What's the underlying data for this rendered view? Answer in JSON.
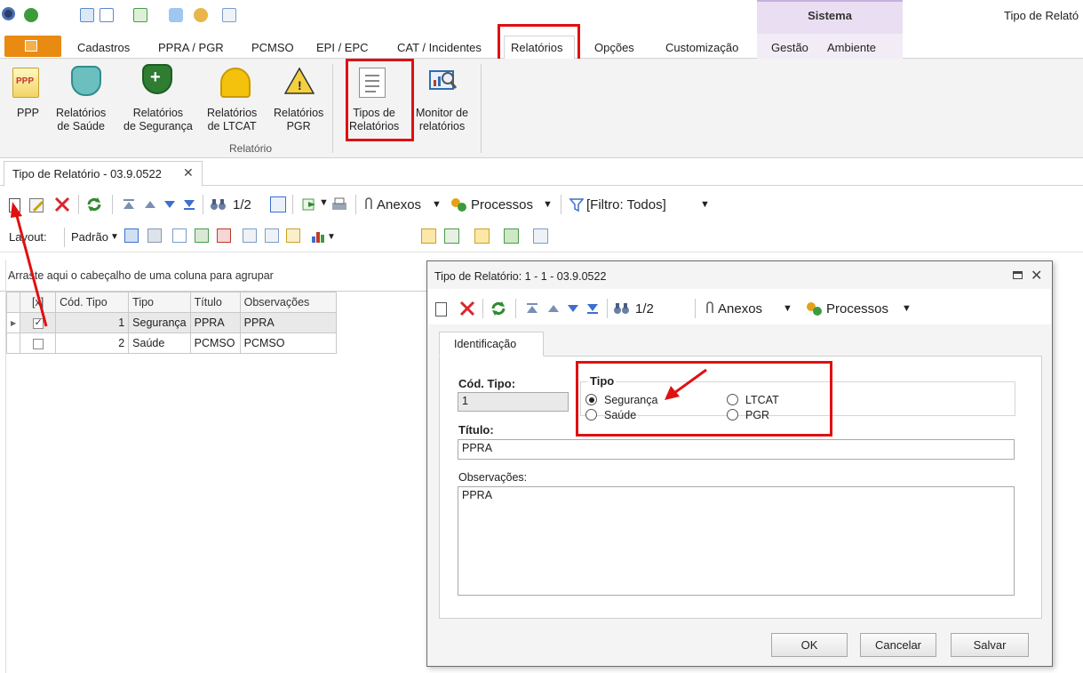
{
  "window": {
    "title": "Tipo de Relató",
    "sistema": "Sistema"
  },
  "ribbon": {
    "tabs": [
      "Cadastros",
      "PPRA / PGR",
      "PCMSO",
      "EPI / EPC",
      "CAT / Incidentes",
      "Relatórios",
      "Opções",
      "Customização",
      "Gestão",
      "Ambiente"
    ],
    "active_tab": "Relatórios",
    "buttons": [
      {
        "line1": "PPP",
        "line2": ""
      },
      {
        "line1": "Relatórios",
        "line2": "de Saúde"
      },
      {
        "line1": "Relatórios",
        "line2": "de Segurança"
      },
      {
        "line1": "Relatórios",
        "line2": "de LTCAT"
      },
      {
        "line1": "Relatórios",
        "line2": "PGR"
      },
      {
        "line1": "Tipos de",
        "line2": "Relatórios"
      },
      {
        "line1": "Monitor de",
        "line2": "relatórios"
      }
    ],
    "group_label": "Relatório"
  },
  "document_tab": {
    "label": "Tipo de Relatório - 03.9.0522",
    "close": "✕"
  },
  "toolbar1": {
    "page": "1/2",
    "anexos": "Anexos",
    "processos": "Processos",
    "filtro": "[Filtro: Todos]"
  },
  "toolbar2": {
    "layout": "Layout:",
    "padrao": "Padrão"
  },
  "grid": {
    "group_hint": "Arraste aqui o cabeçalho de uma coluna para agrupar",
    "columns": [
      "[x]",
      "Cód. Tipo",
      "Tipo",
      "Título",
      "Observações"
    ],
    "rows": [
      {
        "selected": true,
        "checked": true,
        "cod": "1",
        "tipo": "Segurança",
        "titulo": "PPRA",
        "obs": "PPRA"
      },
      {
        "selected": false,
        "checked": false,
        "cod": "2",
        "tipo": "Saúde",
        "titulo": "PCMSO",
        "obs": "PCMSO"
      }
    ]
  },
  "dialog": {
    "title": "Tipo de Relatório: 1 - 1 - 03.9.0522",
    "toolbar": {
      "page": "1/2",
      "anexos": "Anexos",
      "processos": "Processos"
    },
    "tab": "Identificação",
    "cod_tipo_label": "Cód. Tipo:",
    "cod_tipo_value": "1",
    "tipo_label": "Tipo",
    "tipo_options": {
      "seguranca": "Segurança",
      "saude": "Saúde",
      "ltcat": "LTCAT",
      "pgr": "PGR"
    },
    "tipo_selected": "Segurança",
    "titulo_label": "Título:",
    "titulo_value": "PPRA",
    "obs_label": "Observações:",
    "obs_value": "PPRA",
    "buttons": {
      "ok": "OK",
      "cancelar": "Cancelar",
      "salvar": "Salvar"
    }
  },
  "colors": {
    "annotation": "#e01010",
    "file_tab": "#e98a12",
    "sistema_band": "#eadff2"
  }
}
